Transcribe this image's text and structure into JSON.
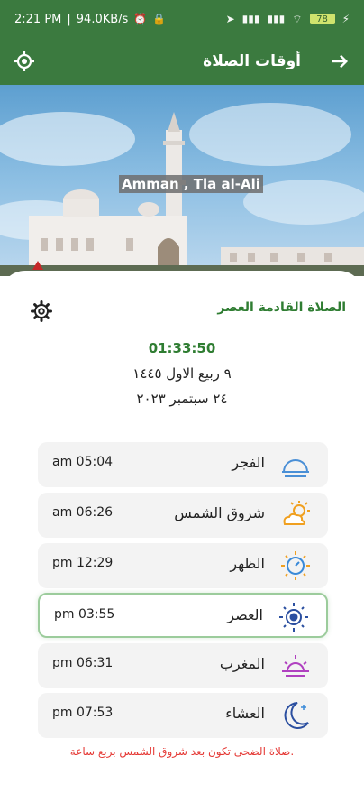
{
  "status_bar": {
    "time": "2:21 PM",
    "speed": "94.0KB/s",
    "battery": "78"
  },
  "app_bar": {
    "title": "أوقات الصلاة"
  },
  "location": "Amman , Tla al-Ali",
  "next_prayer_label": "الصلاة القادمة العصر",
  "countdown": "01:33:50",
  "hijri_date": "٩ ربيع الاول ١٤٤٥",
  "gregorian_date": "٢٤ سبتمبر ٢٠٢٣",
  "prayers": [
    {
      "name": "الفجر",
      "time": "am 05:04",
      "icon": "fajr-icon"
    },
    {
      "name": "شروق الشمس",
      "time": "am 06:26",
      "icon": "sunrise-icon"
    },
    {
      "name": "الظهر",
      "time": "pm 12:29",
      "icon": "dhuhr-sun-icon"
    },
    {
      "name": "العصر",
      "time": "pm 03:55",
      "icon": "asr-sun-icon",
      "active": true
    },
    {
      "name": "المغرب",
      "time": "pm 06:31",
      "icon": "maghrib-sunset-icon"
    },
    {
      "name": "العشاء",
      "time": "pm 07:53",
      "icon": "isha-moon-icon"
    }
  ],
  "footer_note": "صلاة الضحى تكون بعد شروق الشمس بربع ساعة.",
  "colors": {
    "primary": "#3b7a3f",
    "accent_text": "#2f7d32",
    "note": "#e53935",
    "active_border": "#9ccc9c"
  }
}
